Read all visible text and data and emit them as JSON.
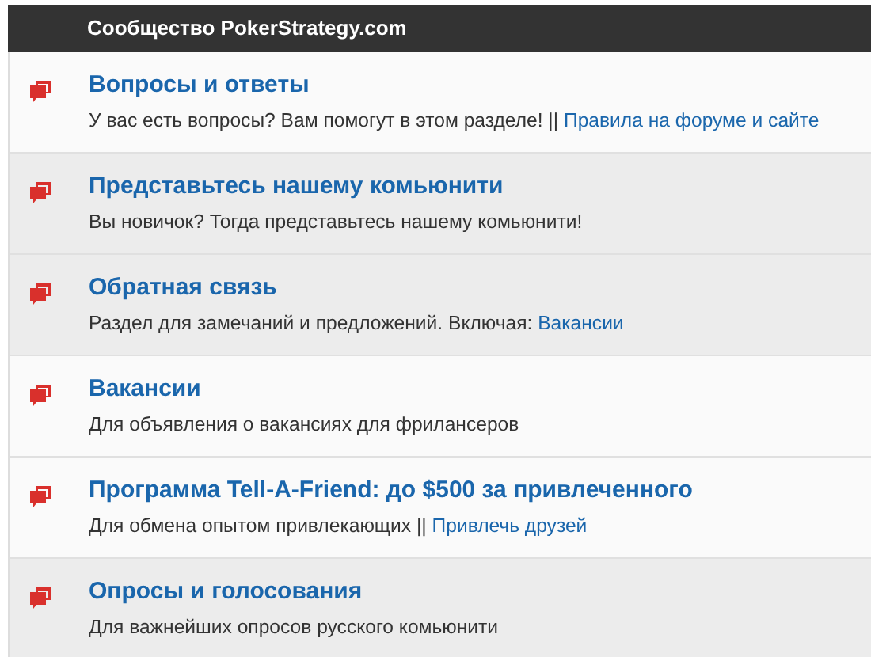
{
  "header": {
    "title": "Сообщество PokerStrategy.com"
  },
  "forums": [
    {
      "title": "Вопросы и ответы",
      "shaded": false,
      "description": [
        {
          "kind": "text",
          "text": "У вас есть вопросы? Вам помогут в этом разделе! || "
        },
        {
          "kind": "link",
          "text": "Правила на форуме и сайте"
        }
      ]
    },
    {
      "title": "Представьтесь нашему комьюнити",
      "shaded": true,
      "description": [
        {
          "kind": "text",
          "text": "Вы новичок? Тогда представьтесь нашему комьюнити!"
        }
      ]
    },
    {
      "title": "Обратная связь",
      "shaded": true,
      "description": [
        {
          "kind": "text",
          "text": "Раздел для замечаний и предложений. Включая: "
        },
        {
          "kind": "link",
          "text": "Вакансии"
        }
      ]
    },
    {
      "title": "Вакансии",
      "shaded": false,
      "description": [
        {
          "kind": "text",
          "text": "Для объявления о вакансиях для фрилансеров"
        }
      ]
    },
    {
      "title": "Программа Tell-A-Friend: до $500 за привлеченного",
      "shaded": false,
      "description": [
        {
          "kind": "text",
          "text": "Для обмена опытом привлекающих || "
        },
        {
          "kind": "link",
          "text": "Привлечь друзей"
        }
      ]
    },
    {
      "title": "Опросы и голосования",
      "shaded": true,
      "description": [
        {
          "kind": "text",
          "text": "Для важнейших опросов русского комьюнити"
        }
      ]
    }
  ]
}
